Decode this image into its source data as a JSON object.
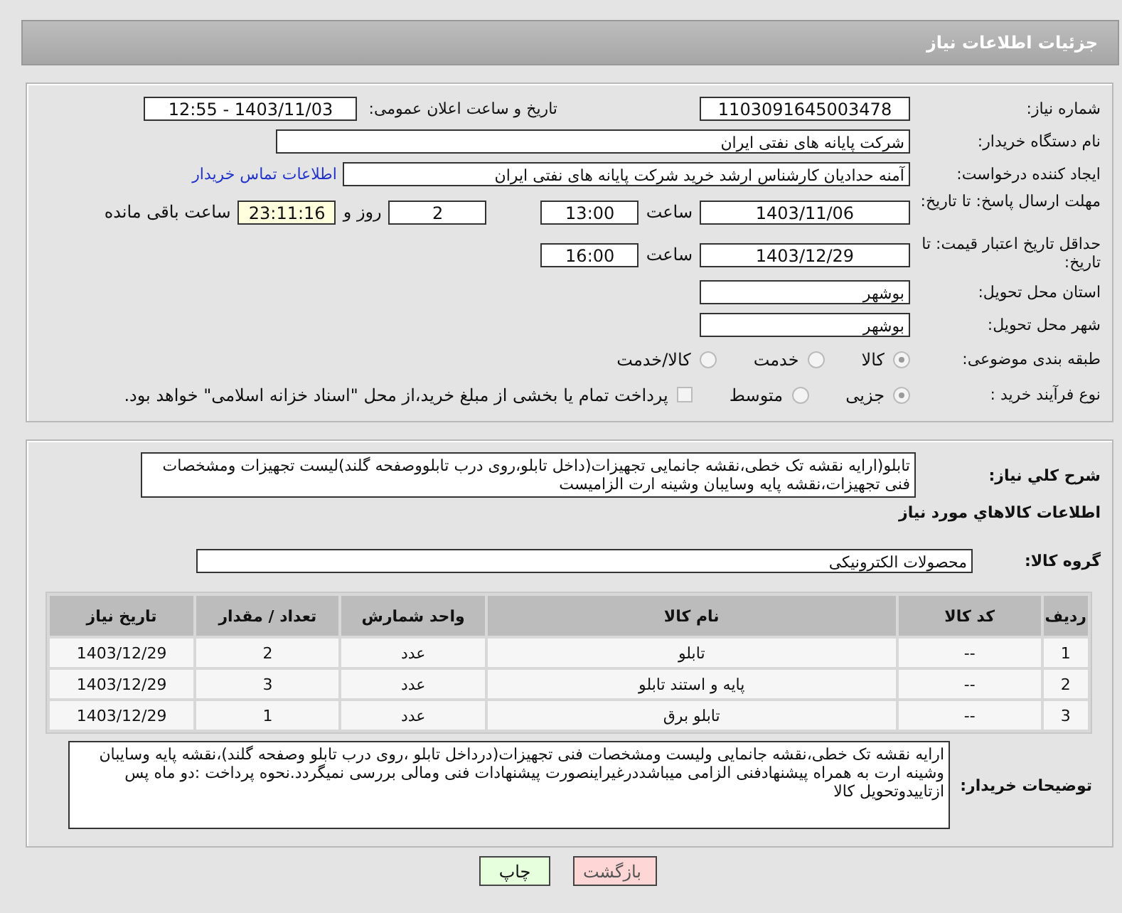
{
  "header": {
    "title": "جزئیات اطلاعات نیاز"
  },
  "need_number": {
    "label": "شماره نیاز:",
    "value": "1103091645003478"
  },
  "announce": {
    "label": "تاریخ و ساعت اعلان عمومی:",
    "value": "1403/11/03 - 12:55"
  },
  "buyer_org": {
    "label": "نام دستگاه خریدار:",
    "value": "شرکت پایانه های نفتی ایران"
  },
  "requester": {
    "label": "ایجاد کننده درخواست:",
    "value": "آمنه  حدادیان  کارشناس ارشد خرید  شرکت پایانه های نفتی ایران",
    "link": "اطلاعات تماس خریدار"
  },
  "reply_deadline": {
    "label": "مهلت ارسال پاسخ: تا تاریخ:",
    "date": "1403/11/06",
    "time_label": "ساعت",
    "time": "13:00",
    "days": "2",
    "days_label": "روز و",
    "remaining": "23:11:16",
    "remaining_label": "ساعت باقی مانده"
  },
  "price_validity": {
    "label": "حداقل تاریخ اعتبار قیمت: تا تاریخ:",
    "date": "1403/12/29",
    "time_label": "ساعت",
    "time": "16:00"
  },
  "province": {
    "label": "استان محل تحویل:",
    "value": "بوشهر"
  },
  "city": {
    "label": "شهر محل تحویل:",
    "value": "بوشهر"
  },
  "category": {
    "label": "طبقه بندی موضوعی:",
    "options": [
      {
        "label": "کالا",
        "selected": true
      },
      {
        "label": "خدمت",
        "selected": false
      },
      {
        "label": "کالا/خدمت",
        "selected": false
      }
    ]
  },
  "process": {
    "label": "نوع فرآیند خرید :",
    "options": [
      {
        "label": "جزیی",
        "selected": true
      },
      {
        "label": "متوسط",
        "selected": false
      }
    ],
    "treasury": {
      "label": "پرداخت تمام یا بخشی از مبلغ خرید،از محل \"اسناد خزانه اسلامی\" خواهد بود.",
      "checked": false
    }
  },
  "summary": {
    "label": "شرح کلي نياز:",
    "value": "تابلو(ارایه نقشه تک خطی،نقشه جانمایی تجهیزات(داخل تابلو،روی درب تابلووصفحه گلند)لیست تجهیزات ومشخصات فنی تجهیزات،نقشه پایه وسایبان وشینه ارت الزامیست"
  },
  "goods_heading": "اطلاعات کالاهاي مورد نياز",
  "goods_group": {
    "label": "گروه کالا:",
    "value": "محصولات الکترونیکی"
  },
  "table": {
    "columns": [
      "ردیف",
      "کد کالا",
      "نام کالا",
      "واحد شمارش",
      "تعداد / مقدار",
      "تاریخ نیاز"
    ],
    "rows": [
      [
        "1",
        "--",
        "تابلو",
        "عدد",
        "2",
        "1403/12/29"
      ],
      [
        "2",
        "--",
        "پایه و استند تابلو",
        "عدد",
        "3",
        "1403/12/29"
      ],
      [
        "3",
        "--",
        "تابلو برق",
        "عدد",
        "1",
        "1403/12/29"
      ]
    ]
  },
  "buyer_notes": {
    "label": "توضیحات خریدار:",
    "value": "ارایه نقشه تک خطی،نقشه جانمایی ولیست ومشخصات فنی تجهیزات(درداخل تابلو ،روی درب تابلو وصفحه گلند)،نقشه پایه وسایبان وشینه ارت به همراه پیشنهادفنی الزامی میباشددرغیراینصورت پیشنهادات فنی ومالی بررسی نمیگردد.نحوه پرداخت :دو ماه پس ازتاییدوتحویل کالا"
  },
  "buttons": [
    {
      "label": "بازگشت",
      "kind": "back"
    },
    {
      "label": "چاپ",
      "kind": "print"
    }
  ]
}
